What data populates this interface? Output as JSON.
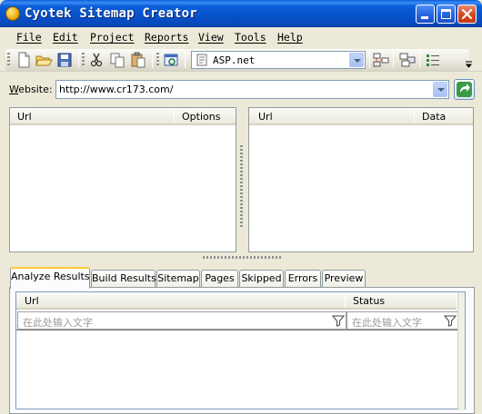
{
  "window": {
    "title": "Cyotek Sitemap Creator"
  },
  "menu": [
    "File",
    "Edit",
    "Project",
    "Reports",
    "View",
    "Tools",
    "Help"
  ],
  "toolbar": {
    "language_selected": "ASP.net"
  },
  "website": {
    "label_underlined": "W",
    "label_rest": "ebsite:",
    "url": "http://www.cr173.com/"
  },
  "left_panel": {
    "columns": [
      "Url",
      "Options"
    ]
  },
  "right_panel": {
    "columns": [
      "Url",
      "Data"
    ]
  },
  "tabs": [
    "Analyze Results",
    "Build Results",
    "Sitemap",
    "Pages",
    "Skipped",
    "Errors",
    "Preview"
  ],
  "active_tab": "Analyze Results",
  "results": {
    "columns": [
      "Url",
      "Status"
    ],
    "filter_placeholder": "在此处输入文字"
  },
  "colors": {
    "titlebar": "#0a5fd8",
    "window_bg": "#ece9d8",
    "active_tab_accent": "#ffc83c"
  }
}
